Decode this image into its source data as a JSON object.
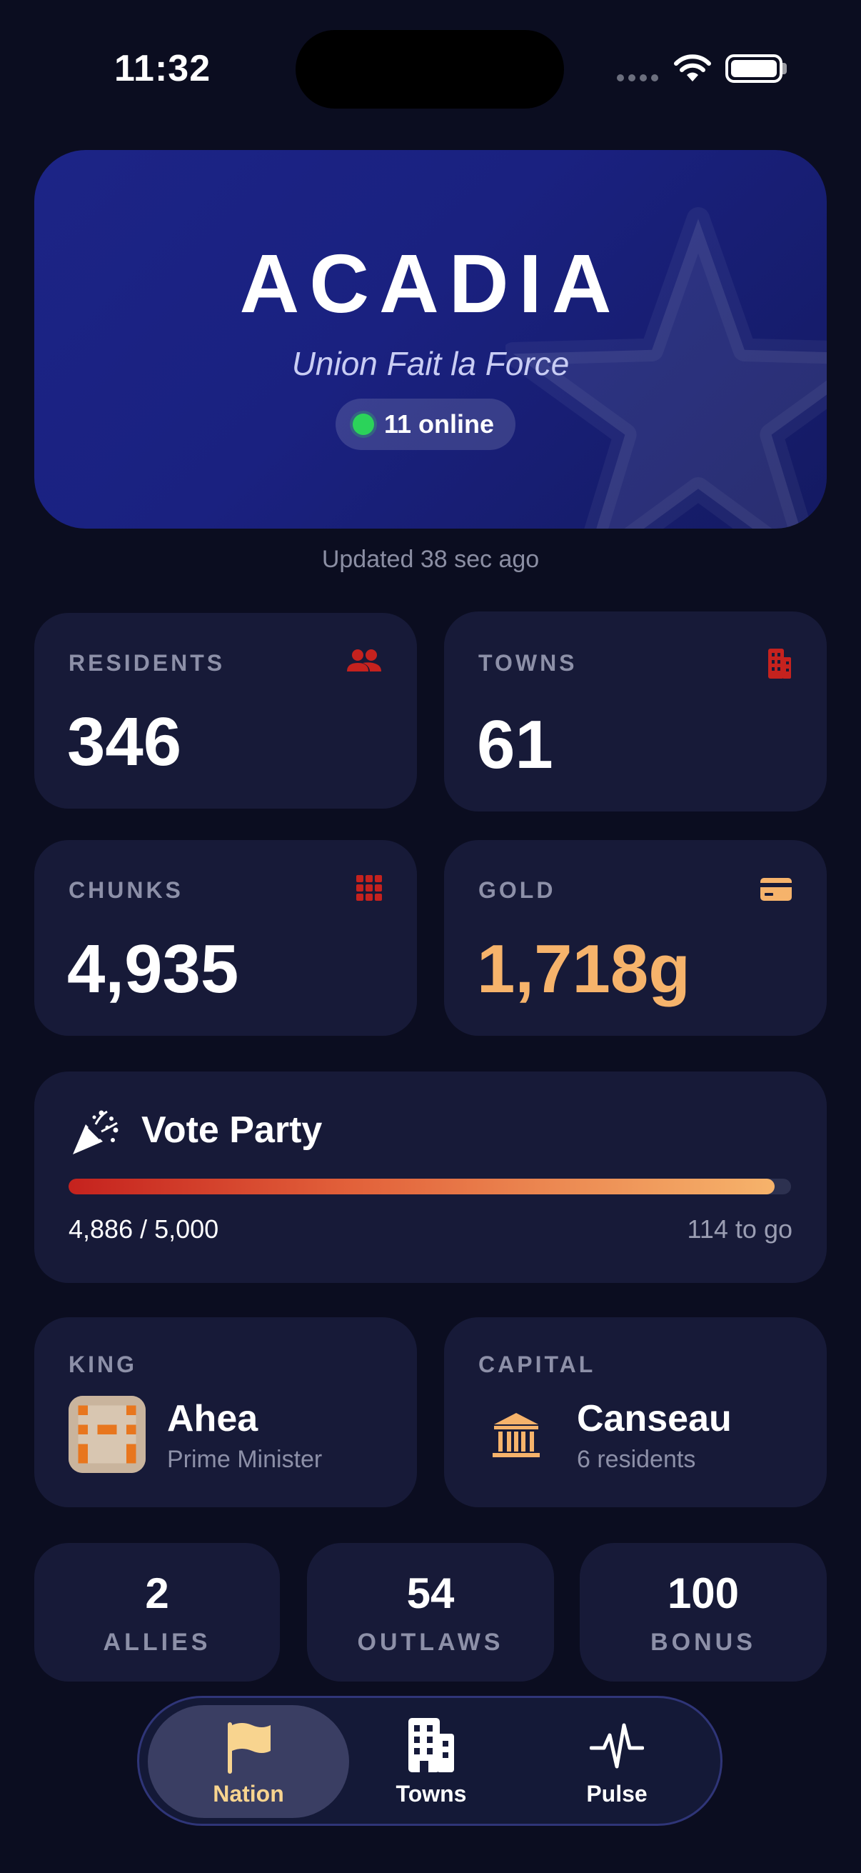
{
  "status_bar": {
    "time": "11:32"
  },
  "hero": {
    "title": "ACADIA",
    "motto": "Union Fait la Force",
    "online_text": "11 online",
    "colors": {
      "online_dot": "#2bd35a",
      "hero_bg": "#1c2486"
    }
  },
  "updated_text": "Updated 38 sec ago",
  "stats": [
    {
      "label": "RESIDENTS",
      "value": "346",
      "icon": "people-icon"
    },
    {
      "label": "TOWNS",
      "value": "61",
      "icon": "building-icon"
    },
    {
      "label": "CHUNKS",
      "value": "4,935",
      "icon": "grid-icon"
    },
    {
      "label": "GOLD",
      "value": "1,718g",
      "icon": "card-icon"
    }
  ],
  "vote_party": {
    "title": "Vote Party",
    "count_text": "4,886 / 5,000",
    "remaining_text": "114 to go",
    "progress": 0.9772
  },
  "king": {
    "label": "KING",
    "name": "Ahea",
    "subtitle": "Prime Minister"
  },
  "capital": {
    "label": "CAPITAL",
    "name": "Canseau",
    "subtitle": "6 residents"
  },
  "mini_stats": [
    {
      "value": "2",
      "label": "ALLIES"
    },
    {
      "value": "54",
      "label": "OUTLAWS"
    },
    {
      "value": "100",
      "label": "BONUS"
    }
  ],
  "tabs": [
    {
      "label": "Nation",
      "active": true
    },
    {
      "label": "Towns",
      "active": false
    },
    {
      "label": "Pulse",
      "active": false
    }
  ],
  "colors": {
    "background": "#0b0d20",
    "card": "#171a38",
    "accent_gold": "#f6b36b",
    "accent_red": "#c5221e"
  }
}
